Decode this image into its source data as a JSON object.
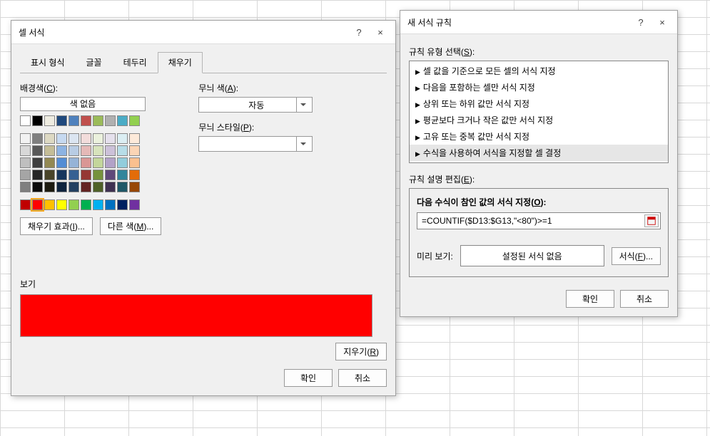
{
  "dialog1": {
    "title": "셀 서식",
    "tabs": {
      "format": "표시 형식",
      "font": "글꼴",
      "border": "테두리",
      "fill": "채우기"
    },
    "bg_label_pre": "배경색(",
    "bg_label_u": "C",
    "bg_label_post": "):",
    "no_color": "색 없음",
    "pattern_color_pre": "무늬 색(",
    "pattern_color_u": "A",
    "pattern_color_post": "):",
    "pattern_color_value": "자동",
    "pattern_style_pre": "무늬 스타일(",
    "pattern_style_u": "P",
    "pattern_style_post": "):",
    "fill_effects_pre": "채우기 효과(",
    "fill_effects_u": "I",
    "fill_effects_post": ")...",
    "more_colors_pre": "다른 색(",
    "more_colors_u": "M",
    "more_colors_post": ")...",
    "preview_label": "보기",
    "preview_color": "#ff0000",
    "clear_pre": "지우기(",
    "clear_u": "R",
    "clear_post": ")",
    "ok": "확인",
    "cancel": "취소",
    "help": "?",
    "close": "×"
  },
  "dialog2": {
    "title": "새 서식 규칙",
    "rule_type_pre": "규칙 유형 선택(",
    "rule_type_u": "S",
    "rule_type_post": "):",
    "rules": [
      "셀 값을 기준으로 모든 셀의 서식 지정",
      "다음을 포함하는 셀만 서식 지정",
      "상위 또는 하위 값만 서식 지정",
      "평균보다 크거나 작은 값만 서식 지정",
      "고유 또는 중복 값만 서식 지정",
      "수식을 사용하여 서식을 지정할 셀 결정"
    ],
    "selected_rule": 5,
    "rule_desc_pre": "규칙 설명 편집(",
    "rule_desc_u": "E",
    "rule_desc_post": "):",
    "formula_label_pre": "다음 수식이 참인 값의 서식 지정(",
    "formula_label_u": "O",
    "formula_label_post": "):",
    "formula_value": "=COUNTIF($D13:$G13,\"<80\")>=1",
    "preview_label": "미리 보기:",
    "preview_text": "설정된 서식 없음",
    "format_btn_pre": "서식(",
    "format_btn_u": "F",
    "format_btn_post": ")...",
    "ok": "확인",
    "cancel": "취소",
    "help": "?",
    "close": "×"
  },
  "palette": {
    "row1": [
      "#ffffff",
      "#000000",
      "#eeece1",
      "#1f497d",
      "#4f81bd",
      "#c0504d",
      "#9bbb59",
      "#b0b0b0",
      "#4bacc6",
      "#92d050"
    ],
    "row_sep": true,
    "tints": [
      [
        "#f2f2f2",
        "#7f7f7f",
        "#ddd9c3",
        "#c6d9f0",
        "#dbe5f1",
        "#f2dcdb",
        "#ebf1dd",
        "#e5e0ec",
        "#dbeef3",
        "#fdeada"
      ],
      [
        "#d8d8d8",
        "#595959",
        "#c4bd97",
        "#8db3e2",
        "#b8cce4",
        "#e5b9b7",
        "#d7e3bc",
        "#ccc1d9",
        "#b7dde8",
        "#fbd5b5"
      ],
      [
        "#bfbfbf",
        "#3f3f3f",
        "#938953",
        "#548dd4",
        "#95b3d7",
        "#d99694",
        "#c3d69b",
        "#b2a2c7",
        "#92cddc",
        "#fac08f"
      ],
      [
        "#a5a5a5",
        "#262626",
        "#494429",
        "#17365d",
        "#366092",
        "#953734",
        "#76923c",
        "#5f497a",
        "#31859b",
        "#e36c09"
      ],
      [
        "#7f7f7f",
        "#0c0c0c",
        "#1d1b10",
        "#0f243e",
        "#244061",
        "#632423",
        "#4f6128",
        "#3f3151",
        "#205867",
        "#974806"
      ]
    ],
    "standard": [
      "#c00000",
      "#ff0000",
      "#ffc000",
      "#ffff00",
      "#92d050",
      "#00b050",
      "#00b0f0",
      "#0070c0",
      "#002060",
      "#7030a0"
    ],
    "selected_index": 1
  }
}
